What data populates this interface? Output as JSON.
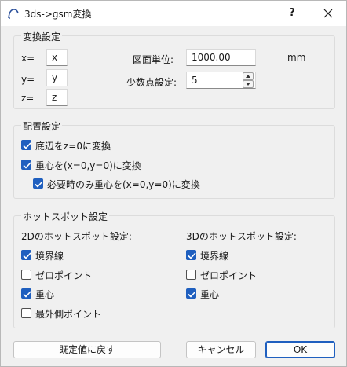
{
  "window": {
    "title": "3ds->gsm変換",
    "help_label": "?"
  },
  "conversion": {
    "title": "変換設定",
    "x_label": "x=",
    "x_value": "x",
    "y_label": "y=",
    "y_value": "y",
    "z_label": "z=",
    "z_value": "z",
    "unit_label": "図面単位:",
    "unit_value": "1000.00",
    "unit_suffix": "mm",
    "decimal_label": "少数点設定:",
    "decimal_value": "5"
  },
  "placement": {
    "title": "配置設定",
    "options": [
      {
        "label": "底辺をz=0に変換",
        "checked": true
      },
      {
        "label": "重心を(x=0,y=0)に変換",
        "checked": true
      },
      {
        "label": "必要時のみ重心を(x=0,y=0)に変換",
        "checked": true
      }
    ]
  },
  "hotspot": {
    "title": "ホットスポット設定",
    "left_heading": "2Dのホットスポット設定:",
    "right_heading": "3Dのホットスポット設定:",
    "left_options": [
      {
        "label": "境界線",
        "checked": true
      },
      {
        "label": "ゼロポイント",
        "checked": false
      },
      {
        "label": "重心",
        "checked": true
      },
      {
        "label": "最外側ポイント",
        "checked": false
      }
    ],
    "right_options": [
      {
        "label": "境界線",
        "checked": true
      },
      {
        "label": "ゼロポイント",
        "checked": false
      },
      {
        "label": "重心",
        "checked": true
      }
    ]
  },
  "buttons": {
    "reset_label": "既定値に戻す",
    "cancel_label": "キャンセル",
    "ok_label": "OK"
  },
  "colors": {
    "accent": "#1f5fbf",
    "background": "#f0f0f0"
  }
}
